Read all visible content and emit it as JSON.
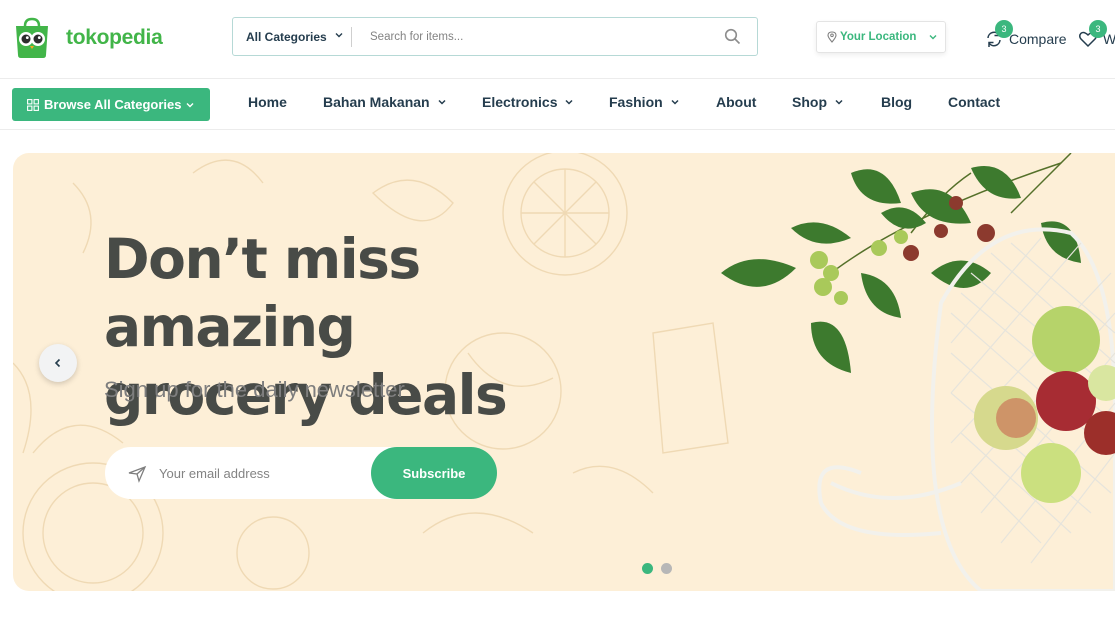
{
  "brand": {
    "name": "tokopedia",
    "color": "#42b549"
  },
  "theme": {
    "accent": "#3bb77e",
    "hero_bg": "#fdefd7",
    "text_dark": "#253d4e"
  },
  "search": {
    "category": "All Categories",
    "placeholder": "Search for items..."
  },
  "location": {
    "label": "Your Location"
  },
  "actions": {
    "compare": {
      "label": "Compare",
      "count": "3",
      "icon": "compare-icon"
    },
    "wishlist": {
      "label": "W",
      "count": "3",
      "icon": "heart-icon"
    }
  },
  "nav": {
    "browse_label": "Browse All Categories",
    "items": [
      {
        "label": "Home",
        "dropdown": false
      },
      {
        "label": "Bahan Makanan",
        "dropdown": true
      },
      {
        "label": "Electronics",
        "dropdown": true
      },
      {
        "label": "Fashion",
        "dropdown": true
      },
      {
        "label": "About",
        "dropdown": false
      },
      {
        "label": "Shop",
        "dropdown": true
      },
      {
        "label": "Blog",
        "dropdown": false
      },
      {
        "label": "Contact",
        "dropdown": false
      }
    ]
  },
  "hero": {
    "title_line1": "Don’t miss amazing",
    "title_line2": "grocery deals",
    "subtitle": "Sign up for the daily newsletter",
    "email_placeholder": "Your email address",
    "subscribe_label": "Subscribe",
    "slides_total": 2,
    "active_slide": 1
  }
}
